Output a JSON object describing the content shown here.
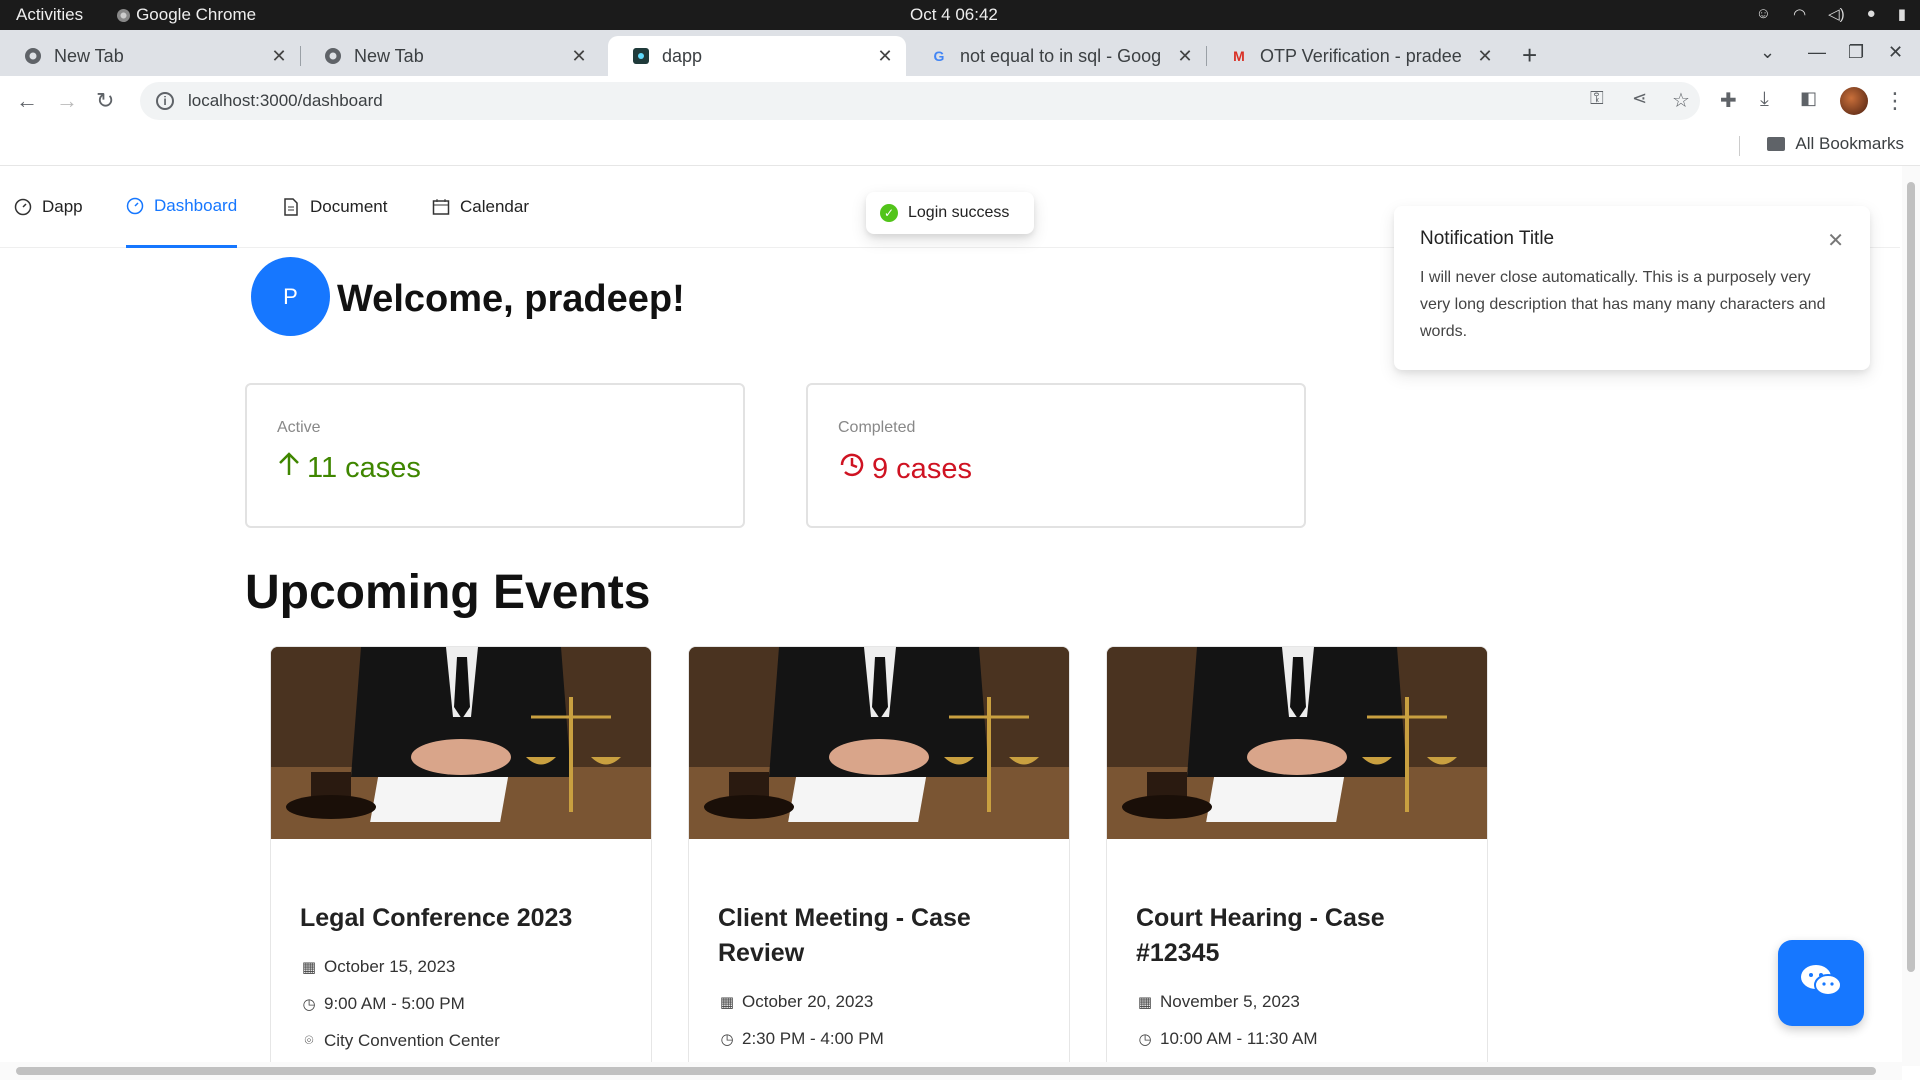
{
  "os": {
    "activities": "Activities",
    "app_name": "Google Chrome",
    "clock": "Oct 4  06:42"
  },
  "tabs": [
    {
      "title": "New Tab",
      "favicon": "chrome-icon"
    },
    {
      "title": "New Tab",
      "favicon": "chrome-icon"
    },
    {
      "title": "dapp",
      "favicon": "react-icon"
    },
    {
      "title": "not equal to in sql - Goog",
      "favicon": "google-icon"
    },
    {
      "title": "OTP Verification - pradee",
      "favicon": "gmail-icon"
    }
  ],
  "address_bar": {
    "url": "localhost:3000/dashboard"
  },
  "bookmarks": {
    "all_label": "All Bookmarks"
  },
  "nav": {
    "items": [
      {
        "label": "Dapp"
      },
      {
        "label": "Dashboard"
      },
      {
        "label": "Document"
      },
      {
        "label": "Calendar"
      }
    ]
  },
  "toast": {
    "message": "Login success"
  },
  "notification": {
    "title": "Notification Title",
    "description": "I will never close automatically. This is a purposely very very long description that has many many characters and words."
  },
  "welcome": {
    "avatar_letter": "P",
    "text": "Welcome, pradeep!"
  },
  "stats": [
    {
      "label": "Active",
      "value": "11 cases",
      "color": "#3f8600"
    },
    {
      "label": "Completed",
      "value": "9 cases",
      "color": "#cf1322"
    }
  ],
  "events": {
    "heading": "Upcoming Events",
    "items": [
      {
        "title": "Legal Conference 2023",
        "date": "October 15, 2023",
        "time": "9:00 AM - 5:00 PM",
        "location": "City Convention Center"
      },
      {
        "title": "Client Meeting - Case Review",
        "date": "October 20, 2023",
        "time": "2:30 PM - 4:00 PM"
      },
      {
        "title": "Court Hearing - Case #12345",
        "date": "November 5, 2023",
        "time": "10:00 AM - 11:30 AM"
      }
    ]
  },
  "colors": {
    "accent": "#1677ff",
    "success": "#52c41a"
  }
}
